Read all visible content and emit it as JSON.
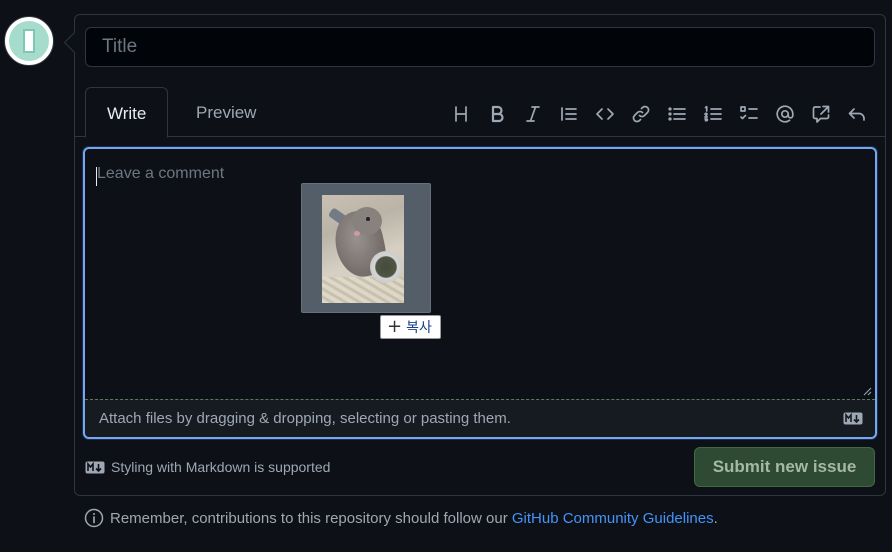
{
  "issue": {
    "title_placeholder": "Title",
    "tabs": [
      {
        "label": "Write",
        "active": true
      },
      {
        "label": "Preview",
        "active": false
      }
    ],
    "toolbar_icons": [
      "heading-icon",
      "bold-icon",
      "italic-icon",
      "quote-icon",
      "code-icon",
      "link-icon",
      "unordered-list-icon",
      "ordered-list-icon",
      "task-list-icon",
      "mention-icon",
      "cross-reference-icon",
      "reply-icon"
    ],
    "comment_placeholder": "Leave a comment",
    "attach_text": "Attach files by dragging & dropping, selecting or pasting them.",
    "markdown_note": "Styling with Markdown is supported",
    "submit_label": "Submit new issue",
    "guidelines_prefix": "Remember, contributions to this repository should follow our ",
    "guidelines_link": "GitHub Community Guidelines",
    "guidelines_suffix": "."
  },
  "drag": {
    "copy_label": "복사"
  },
  "colors": {
    "background": "#0d1117",
    "accent_border": "#7aa6e6",
    "link": "#4493f8",
    "submit_bg": "#2f4a32"
  }
}
